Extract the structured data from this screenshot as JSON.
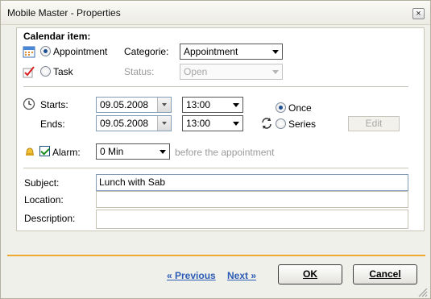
{
  "window": {
    "title": "Mobile Master - Properties",
    "close_glyph": "×"
  },
  "calendar": {
    "heading": "Calendar item:",
    "type_options": [
      {
        "label": "Appointment",
        "selected": true
      },
      {
        "label": "Task",
        "selected": false
      }
    ],
    "category": {
      "label": "Categorie:",
      "value": "Appointment"
    },
    "status": {
      "label": "Status:",
      "value": "Open",
      "disabled": true
    }
  },
  "schedule": {
    "starts": {
      "label": "Starts:",
      "date": "09.05.2008",
      "time": "13:00"
    },
    "ends": {
      "label": "Ends:",
      "date": "09.05.2008",
      "time": "13:00"
    },
    "recurrence": [
      {
        "label": "Once",
        "selected": true
      },
      {
        "label": "Series",
        "selected": false
      }
    ],
    "edit_label": "Edit"
  },
  "alarm": {
    "label": "Alarm:",
    "checked": true,
    "value": "0 Min",
    "suffix": "before the appointment"
  },
  "details": {
    "subject": {
      "label": "Subject:",
      "value": "Lunch with Sab"
    },
    "location": {
      "label": "Location:",
      "value": ""
    },
    "description": {
      "label": "Description:",
      "value": ""
    }
  },
  "footer": {
    "previous_label": "« Previous",
    "next_label": "Next »",
    "ok_label": "OK",
    "cancel_label": "Cancel"
  },
  "icons": {
    "calendar": "calendar-icon",
    "task": "task-check-icon",
    "clock": "clock-icon",
    "recurrence": "recurrence-arrows-icon",
    "alarm": "bell-icon"
  },
  "colors": {
    "accent": "#f0a92f",
    "link": "#2b5bb5"
  }
}
